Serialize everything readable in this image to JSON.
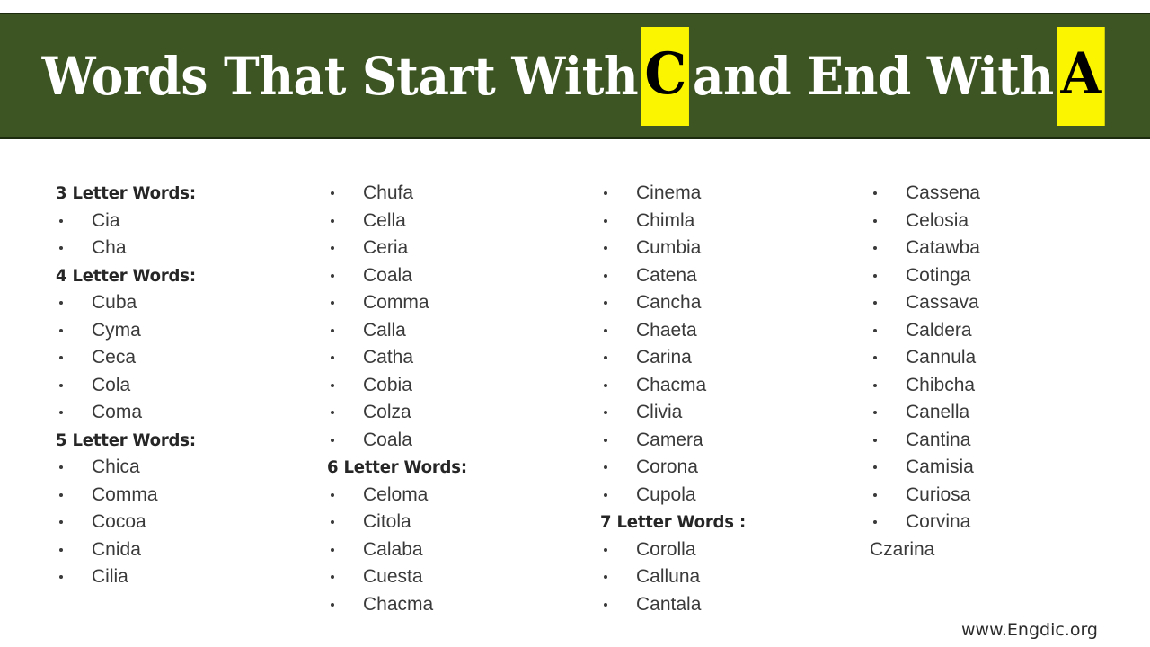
{
  "banner": {
    "background_color": "#3c5522",
    "highlight_color": "#fbf500",
    "text_color": "#ffffff",
    "title_part1": "Words That Start With",
    "title_highlight1": "C",
    "title_part2": "and End With",
    "title_highlight2": "A"
  },
  "footer": {
    "site": "www.Engdic.org"
  },
  "columns": [
    {
      "blocks": [
        {
          "type": "heading",
          "text": "3 Letter Words:"
        },
        {
          "type": "item",
          "text": "Cia"
        },
        {
          "type": "item",
          "text": "Cha"
        },
        {
          "type": "heading",
          "text": "4 Letter Words:"
        },
        {
          "type": "item",
          "text": "Cuba"
        },
        {
          "type": "item",
          "text": "Cyma"
        },
        {
          "type": "item",
          "text": "Ceca"
        },
        {
          "type": "item",
          "text": "Cola"
        },
        {
          "type": "item",
          "text": "Coma"
        },
        {
          "type": "heading",
          "text": "5 Letter Words:"
        },
        {
          "type": "item",
          "text": "Chica"
        },
        {
          "type": "item",
          "text": "Comma"
        },
        {
          "type": "item",
          "text": "Cocoa"
        },
        {
          "type": "item",
          "text": "Cnida"
        },
        {
          "type": "item",
          "text": "Cilia"
        }
      ]
    },
    {
      "blocks": [
        {
          "type": "item",
          "text": "Chufa"
        },
        {
          "type": "item",
          "text": "Cella"
        },
        {
          "type": "item",
          "text": "Ceria"
        },
        {
          "type": "item",
          "text": "Coala"
        },
        {
          "type": "item",
          "text": "Comma"
        },
        {
          "type": "item",
          "text": "Calla"
        },
        {
          "type": "item",
          "text": "Catha"
        },
        {
          "type": "item",
          "text": "Cobia"
        },
        {
          "type": "item",
          "text": "Colza"
        },
        {
          "type": "item",
          "text": "Coala"
        },
        {
          "type": "heading",
          "text": "6 Letter Words:"
        },
        {
          "type": "item",
          "text": "Celoma"
        },
        {
          "type": "item",
          "text": "Citola"
        },
        {
          "type": "item",
          "text": "Calaba"
        },
        {
          "type": "item",
          "text": "Cuesta"
        },
        {
          "type": "item",
          "text": "Chacma"
        }
      ]
    },
    {
      "blocks": [
        {
          "type": "item",
          "text": "Cinema"
        },
        {
          "type": "item",
          "text": "Chimla"
        },
        {
          "type": "item",
          "text": "Cumbia"
        },
        {
          "type": "item",
          "text": "Catena"
        },
        {
          "type": "item",
          "text": "Cancha"
        },
        {
          "type": "item",
          "text": "Chaeta"
        },
        {
          "type": "item",
          "text": "Carina"
        },
        {
          "type": "item",
          "text": "Chacma"
        },
        {
          "type": "item",
          "text": "Clivia"
        },
        {
          "type": "item",
          "text": "Camera"
        },
        {
          "type": "item",
          "text": "Corona"
        },
        {
          "type": "item",
          "text": "Cupola"
        },
        {
          "type": "heading",
          "text": "7 Letter Words :"
        },
        {
          "type": "item",
          "text": "Corolla"
        },
        {
          "type": "item",
          "text": "Calluna"
        },
        {
          "type": "item",
          "text": "Cantala"
        }
      ]
    },
    {
      "blocks": [
        {
          "type": "item",
          "text": "Cassena"
        },
        {
          "type": "item",
          "text": "Celosia"
        },
        {
          "type": "item",
          "text": "Catawba"
        },
        {
          "type": "item",
          "text": "Cotinga"
        },
        {
          "type": "item",
          "text": "Cassava"
        },
        {
          "type": "item",
          "text": "Caldera"
        },
        {
          "type": "item",
          "text": "Cannula"
        },
        {
          "type": "item",
          "text": "Chibcha"
        },
        {
          "type": "item",
          "text": "Canella"
        },
        {
          "type": "item",
          "text": "Cantina"
        },
        {
          "type": "item",
          "text": "Camisia"
        },
        {
          "type": "item",
          "text": "Curiosa"
        },
        {
          "type": "item",
          "text": "Corvina"
        },
        {
          "type": "item-nobullet",
          "text": "Czarina"
        }
      ]
    }
  ]
}
